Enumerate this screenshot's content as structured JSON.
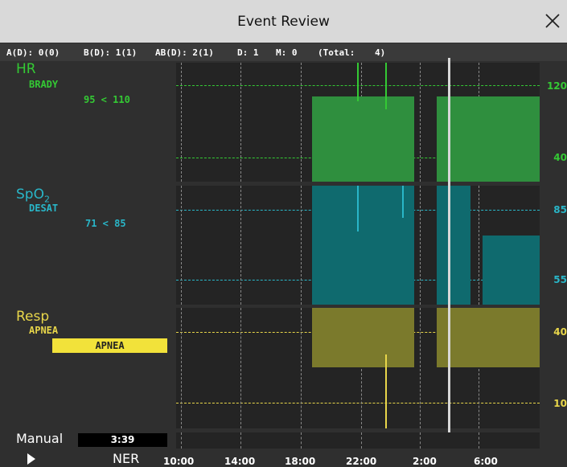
{
  "window": {
    "title": "Event Review"
  },
  "counts": {
    "a": "A(D): 0(0)",
    "b": "B(D): 1(1)",
    "ab": "AB(D): 2(1)",
    "d": "D: 1",
    "m": "M: 0",
    "total_label": "(Total:",
    "total_value": "4)"
  },
  "hr": {
    "label": "HR",
    "alarm": "BRADY",
    "value": "95 < 110",
    "scale_top": "120",
    "scale_bottom": "40"
  },
  "spo2": {
    "label_main": "SpO",
    "label_sub": "2",
    "alarm": "DESAT",
    "value": "71 < 85",
    "scale_top": "85",
    "scale_bottom": "55"
  },
  "resp": {
    "label": "Resp",
    "alarm": "APNEA",
    "banner": "APNEA",
    "scale_top": "40",
    "scale_bottom": "10"
  },
  "footer": {
    "mode": "Manual",
    "timer": "3:39",
    "ner": "NER"
  },
  "time_axis": [
    "10:00",
    "14:00",
    "18:00",
    "22:00",
    "2:00",
    "6:00"
  ],
  "colors": {
    "hr": "#34c934",
    "spo2": "#29b6c8",
    "resp": "#e8d64a",
    "hr_fill": "#2f8f3e",
    "spo2_fill": "#0f6a6e",
    "resp_fill": "#7b7a2c"
  }
}
